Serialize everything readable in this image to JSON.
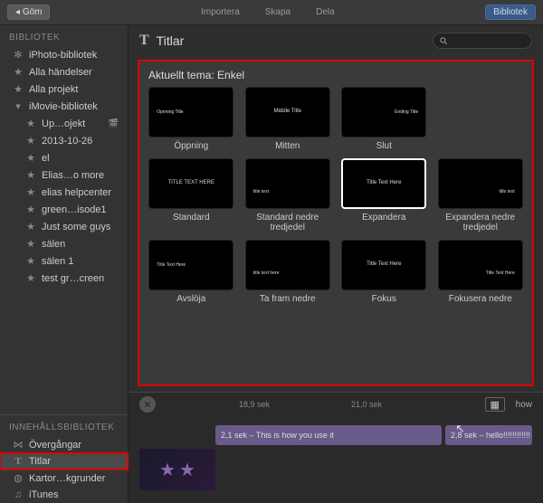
{
  "topbar": {
    "hide": "Göm",
    "import": "Importera",
    "create": "Skapa",
    "share": "Dela",
    "library": "Bibliotek"
  },
  "sidebar": {
    "library_header": "BIBLIOTEK",
    "items": [
      {
        "icon": "sparkle",
        "label": "iPhoto-bibliotek"
      },
      {
        "icon": "star",
        "label": "Alla händelser"
      },
      {
        "icon": "star",
        "label": "Alla projekt"
      },
      {
        "icon": "tri-down",
        "label": "iMovie-bibliotek"
      },
      {
        "icon": "star",
        "label": "Up…ojekt",
        "indent": true,
        "cam": true
      },
      {
        "icon": "star",
        "label": "2013-10-26",
        "indent": true
      },
      {
        "icon": "star",
        "label": "el",
        "indent": true
      },
      {
        "icon": "star",
        "label": "Elias…o more",
        "indent": true
      },
      {
        "icon": "star",
        "label": "elias helpcenter",
        "indent": true
      },
      {
        "icon": "star",
        "label": "green…isode1",
        "indent": true
      },
      {
        "icon": "star",
        "label": "Just some guys",
        "indent": true
      },
      {
        "icon": "star",
        "label": "sälen",
        "indent": true
      },
      {
        "icon": "star",
        "label": "sälen 1",
        "indent": true
      },
      {
        "icon": "star",
        "label": "test gr…creen",
        "indent": true
      }
    ],
    "content_header": "INNEHÅLLSBIBLIOTEK",
    "content_items": [
      {
        "icon": "bowtie",
        "label": "Övergångar"
      },
      {
        "icon": "T",
        "label": "Titlar",
        "sel": true,
        "hl": true
      },
      {
        "icon": "globe",
        "label": "Kartor…kgrunder"
      },
      {
        "icon": "note",
        "label": "iTunes"
      }
    ]
  },
  "content": {
    "icon": "T",
    "title": "Titlar",
    "theme_label": "Aktuellt tema: Enkel",
    "tiles": [
      {
        "label": "Öppning",
        "inner": "Opening Title",
        "pos": "left"
      },
      {
        "label": "Mitten",
        "inner": "Middle Title",
        "pos": "center"
      },
      {
        "label": "Slut",
        "inner": "Ending Title",
        "pos": "right"
      },
      {
        "label": "",
        "inner": "",
        "empty": true
      },
      {
        "label": "Standard",
        "inner": "TITLE TEXT HERE",
        "pos": "center"
      },
      {
        "label": "Standard nedre tredjedel",
        "inner": "title text",
        "pos": "lower",
        "two": true
      },
      {
        "label": "Expandera",
        "inner": "Title Text Here",
        "pos": "center",
        "sel": true
      },
      {
        "label": "Expandera nedre tredjedel",
        "inner": "title text",
        "pos": "lowerright",
        "two": true
      },
      {
        "label": "Avslöja",
        "inner": "Title Text Here",
        "pos": "leftmid"
      },
      {
        "label": "Ta fram nedre",
        "inner": "title text here",
        "pos": "lower"
      },
      {
        "label": "Fokus",
        "inner": "Title Text Here",
        "pos": "center"
      },
      {
        "label": "Fokusera nedre",
        "inner": "Title Text Here",
        "pos": "lowerright"
      }
    ]
  },
  "timeline": {
    "marks": [
      "18,9 sek",
      "21,0 sek"
    ],
    "how": "how",
    "clip_a": "2,1 sek – This is how you use it",
    "clip_b": "2,8 sek – hello!!!!!!!!!!!!"
  }
}
